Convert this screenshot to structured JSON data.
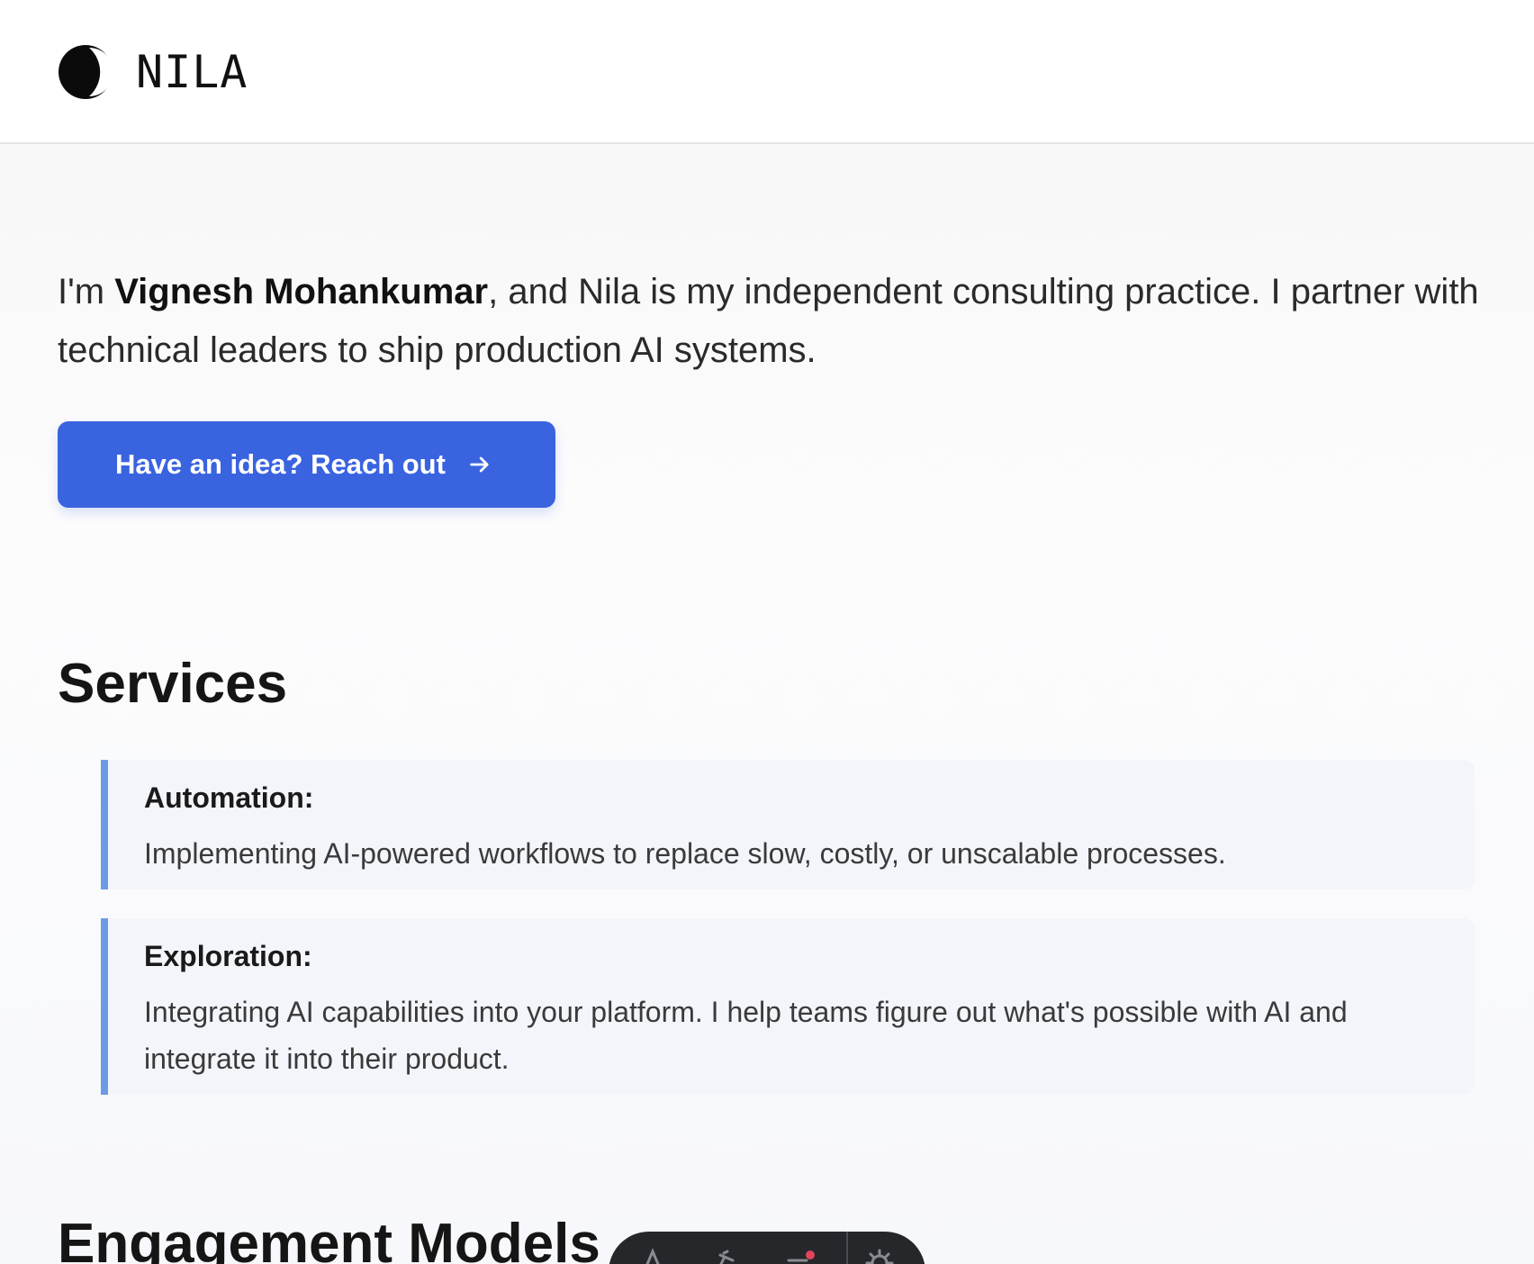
{
  "header": {
    "brand": "NILA",
    "logo_icon": "moon-icon"
  },
  "intro": {
    "prefix": "I'm ",
    "name": "Vignesh Mohankumar",
    "suffix": ", and Nila is my independent consulting practice. I partner with technical leaders to ship production AI systems."
  },
  "cta": {
    "label": "Have an idea? Reach out",
    "icon": "arrow-right-icon",
    "color": "#3a63e0"
  },
  "services": {
    "title": "Services",
    "accent": "#6d9ae6",
    "items": [
      {
        "title": "Automation:",
        "description": "Implementing AI-powered workflows to replace slow, costly, or unscalable processes."
      },
      {
        "title": "Exploration:",
        "description": "Integrating AI capabilities into your platform. I help teams figure out what's possible with AI and integrate it into their product."
      }
    ]
  },
  "engagement": {
    "title": "Engagement Models"
  },
  "toolbar": {
    "icons": [
      "text-icon",
      "pin-icon",
      "menu-lines-icon",
      "gear-icon"
    ],
    "background": "#26272b",
    "notification_color": "#e0445a"
  }
}
